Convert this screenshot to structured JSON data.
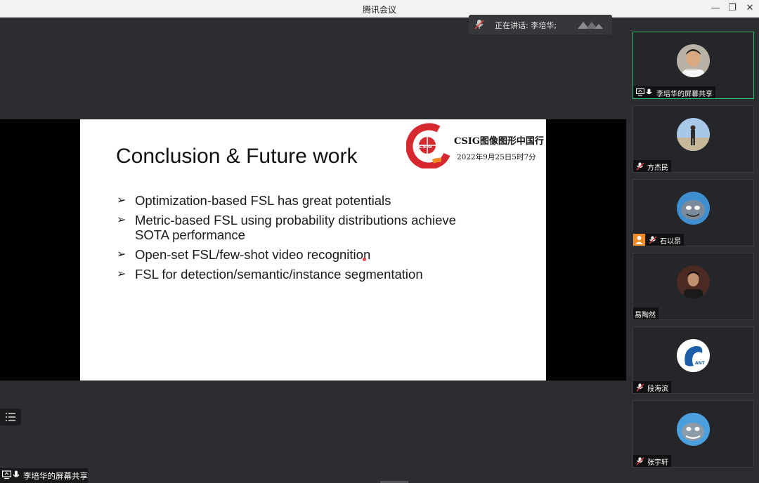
{
  "window": {
    "title": "腾讯会议",
    "minimize": "—",
    "restore": "❐",
    "close": "✕"
  },
  "speaking": {
    "text": "正在讲话: 李培华;"
  },
  "slide": {
    "title": "Conclusion & Future work",
    "logo_text": "CSIG图像图形中国行",
    "date": "2022年9月25日5时7分",
    "bullets": [
      "Optimization-based FSL has great potentials",
      "Metric-based FSL using probability distributions achieve SOTA performance",
      "Open-set FSL/few-shot video recognition",
      "FSL for detection/semantic/instance segmentation"
    ],
    "bullet_marker": "➢"
  },
  "share_label": "李培华的屏幕共享",
  "participants": [
    {
      "name": "李培华的屏幕共享",
      "active": true
    },
    {
      "name": "方杰民",
      "active": false
    },
    {
      "name": "石以昂",
      "active": false
    },
    {
      "name": "易陶然",
      "active": false
    },
    {
      "name": "段海滨",
      "active": false
    },
    {
      "name": "张宇轩",
      "active": false
    }
  ],
  "colors": {
    "active_border": "#2bbf6a",
    "muted_mic": "#e04040",
    "logo_red": "#d7282f",
    "logo_orange": "#f08a24"
  }
}
